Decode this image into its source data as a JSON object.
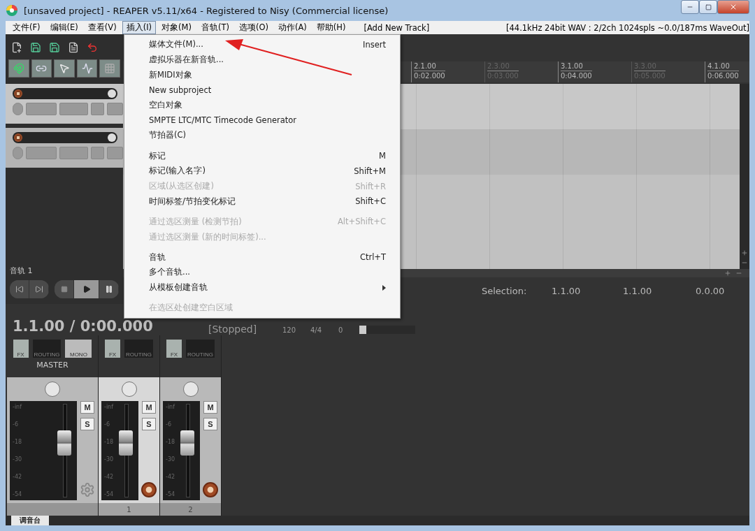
{
  "window": {
    "title": "[unsaved project] - REAPER v5.11/x64 - Registered to Nisy (Commercial license)"
  },
  "menu_bar": {
    "items": [
      {
        "label": "文件(F)",
        "selected": false
      },
      {
        "label": "编辑(E)",
        "selected": false
      },
      {
        "label": "查看(V)",
        "selected": false
      },
      {
        "label": "插入(I)",
        "selected": true
      },
      {
        "label": "对象(M)",
        "selected": false
      },
      {
        "label": "音轨(T)",
        "selected": false
      },
      {
        "label": "选项(O)",
        "selected": false
      },
      {
        "label": "动作(A)",
        "selected": false
      },
      {
        "label": "帮助(H)",
        "selected": false
      }
    ],
    "add_track": "[Add New Track]",
    "audio_status": "[44.1kHz 24bit WAV : 2/2ch 1024spls ~0.0/187ms WaveOut]"
  },
  "insert_menu": {
    "items": [
      {
        "kind": "item",
        "label": "媒体文件(M)...",
        "shortcut": "Insert",
        "disabled": false
      },
      {
        "kind": "item",
        "label": "虚拟乐器在新音轨...",
        "disabled": false
      },
      {
        "kind": "item",
        "label": "新MIDI对象",
        "disabled": false
      },
      {
        "kind": "item",
        "label": "New subproject",
        "disabled": false
      },
      {
        "kind": "item",
        "label": "空白对象",
        "disabled": false
      },
      {
        "kind": "item",
        "label": "SMPTE LTC/MTC Timecode Generator",
        "disabled": false
      },
      {
        "kind": "item",
        "label": "节拍器(C)",
        "disabled": false
      },
      {
        "kind": "separator"
      },
      {
        "kind": "item",
        "label": "标记",
        "shortcut": "M",
        "disabled": false
      },
      {
        "kind": "item",
        "label": "标记(输入名字)",
        "shortcut": "Shift+M",
        "disabled": false
      },
      {
        "kind": "item",
        "label": "区域(从选区创建)",
        "shortcut": "Shift+R",
        "disabled": true
      },
      {
        "kind": "item",
        "label": "时间标签/节拍变化标记",
        "shortcut": "Shift+C",
        "disabled": false
      },
      {
        "kind": "separator"
      },
      {
        "kind": "item",
        "label": "通过选区测量 (检测节拍)",
        "shortcut": "Alt+Shift+C",
        "disabled": true
      },
      {
        "kind": "item",
        "label": "通过选区测量 (新的时间标签)...",
        "disabled": true
      },
      {
        "kind": "separator"
      },
      {
        "kind": "item",
        "label": "音轨",
        "shortcut": "Ctrl+T",
        "disabled": false
      },
      {
        "kind": "item",
        "label": "多个音轨...",
        "disabled": false
      },
      {
        "kind": "submenu",
        "label": "从模板创建音轨",
        "disabled": false
      },
      {
        "kind": "separator"
      },
      {
        "kind": "item",
        "label": "在选区处创建空白区域",
        "disabled": true
      }
    ]
  },
  "ruler": {
    "marks": [
      {
        "bar": "2.1.00",
        "time": "0:02.000",
        "major": true
      },
      {
        "bar": "2.3.00",
        "time": "0:03.000",
        "major": false
      },
      {
        "bar": "3.1.00",
        "time": "0:04.000",
        "major": true
      },
      {
        "bar": "3.3.00",
        "time": "0:05.000",
        "major": false
      },
      {
        "bar": "4.1.00",
        "time": "0:06.000",
        "major": true
      }
    ]
  },
  "transport": {
    "track_label": "音轨 1",
    "time": "1.1.00 / 0:00.000",
    "state": "[Stopped]",
    "tempo": "120",
    "signature": "4/4",
    "rate": "0",
    "rate_slider": {
      "level": 0
    }
  },
  "selection": {
    "label": "Selection:",
    "start": "1.1.00",
    "end": "1.1.00",
    "length": "0.0.00"
  },
  "mixer": {
    "master": {
      "label": "MASTER",
      "buttons": [
        "FX",
        "ROUTING",
        "MONO"
      ],
      "mute": "M",
      "solo": "S",
      "scale": [
        "-inf",
        "-6",
        "-18",
        "-30",
        "-42",
        "-54"
      ]
    },
    "tracks": [
      {
        "number": "1",
        "selected": true,
        "buttons": [
          "FX",
          "ROUTING"
        ],
        "mute": "M",
        "solo": "S",
        "scale": [
          "-inf",
          "-6",
          "-18",
          "-30",
          "-42",
          "-54"
        ]
      },
      {
        "number": "2",
        "selected": false,
        "buttons": [
          "FX",
          "ROUTING"
        ],
        "mute": "M",
        "solo": "S",
        "scale": [
          "-inf",
          "-6",
          "-18",
          "-30",
          "-42",
          "-54"
        ]
      }
    ]
  },
  "bottom_tab": {
    "label": "调音台",
    "selected": true
  }
}
